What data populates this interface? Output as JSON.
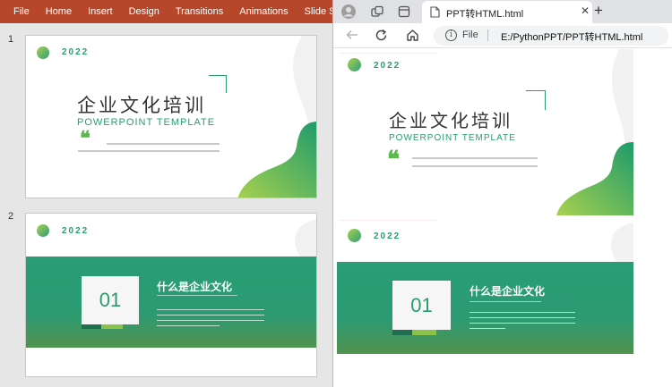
{
  "powerpoint": {
    "ribbon_tabs": [
      "File",
      "Home",
      "Insert",
      "Design",
      "Transitions",
      "Animations",
      "Slide Show"
    ],
    "slides": [
      {
        "number": "1",
        "year": "2022",
        "title_cn": "企业文化培训",
        "title_en": "POWERPOINT TEMPLATE"
      },
      {
        "number": "2",
        "year": "2022",
        "number_box": "01",
        "heading": "什么是企业文化"
      }
    ]
  },
  "browser": {
    "tab_title": "PPT转HTML.html",
    "url_label": "File",
    "url": "E:/PythonPPT/PPT转HTML.html",
    "close_glyph": "✕",
    "new_tab_glyph": "+",
    "slides": [
      {
        "year": "2022",
        "title_cn": "企业文化培训",
        "title_en": "POWERPOINT TEMPLATE"
      },
      {
        "year": "2022",
        "number_box": "01",
        "heading": "什么是企业文化"
      }
    ]
  },
  "colors": {
    "ribbon": "#b7472a",
    "accent": "#2a9d6e",
    "light_green": "#8bc34a",
    "tabbar": "#dfe1e5"
  }
}
